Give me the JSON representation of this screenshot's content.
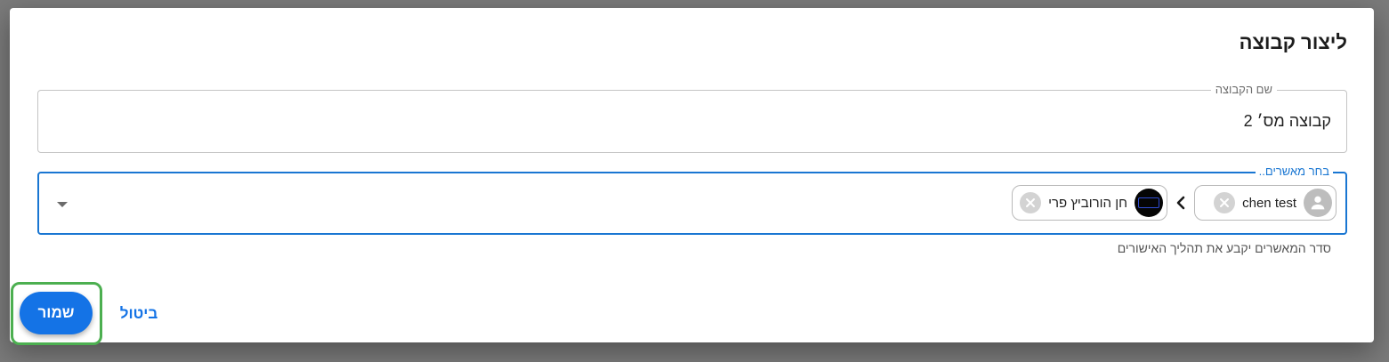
{
  "dialog": {
    "title": "ליצור קבוצה",
    "group_name": {
      "label": "שם הקבוצה",
      "value": "קבוצה מס׳ 2"
    },
    "approvers": {
      "label": "בחר מאשרים..",
      "chips": [
        {
          "label": "chen test",
          "avatar": "person-icon"
        },
        {
          "label": "חן הורוביץ פרי",
          "avatar": "profile-photo"
        }
      ],
      "separator_icon": "chevron-left-icon",
      "dropdown_icon": "arrow-drop-down-icon",
      "helper_text": "סדר המאשרים יקבע את תהליך האישורים"
    },
    "actions": {
      "save_label": "שמור",
      "cancel_label": "ביטול"
    }
  },
  "colors": {
    "primary": "#1473e6",
    "focus_border": "#1976d2",
    "highlight": "#4caf50",
    "overlay": "#7a7a7a"
  }
}
